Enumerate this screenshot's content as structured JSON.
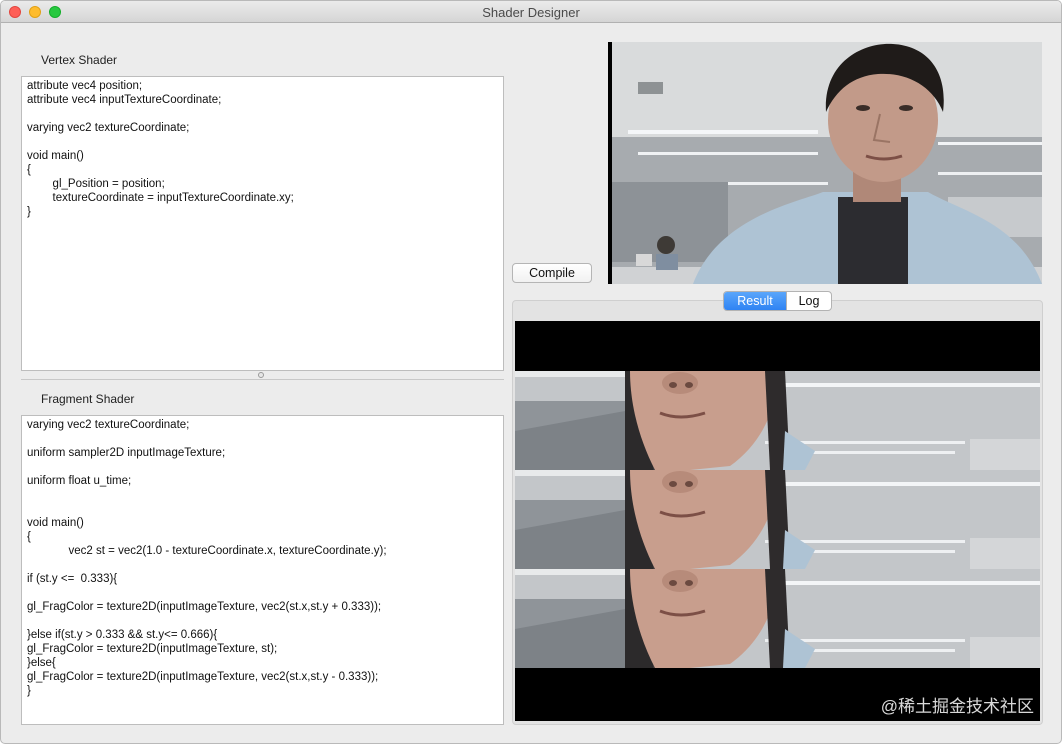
{
  "window": {
    "title": "Shader Designer"
  },
  "vertex": {
    "label": "Vertex Shader",
    "code": "attribute vec4 position;\nattribute vec4 inputTextureCoordinate;\n\nvarying vec2 textureCoordinate;\n\nvoid main()\n{\n        gl_Position = position;\n        textureCoordinate = inputTextureCoordinate.xy;\n}"
  },
  "fragment": {
    "label": "Fragment Shader",
    "code": "varying vec2 textureCoordinate;\n\nuniform sampler2D inputImageTexture;\n\nuniform float u_time;\n\n\nvoid main()\n{\n             vec2 st = vec2(1.0 - textureCoordinate.x, textureCoordinate.y);\n\nif (st.y <=  0.333){\n\ngl_FragColor = texture2D(inputImageTexture, vec2(st.x,st.y + 0.333));\n\n}else if(st.y > 0.333 && st.y<= 0.666){\ngl_FragColor = texture2D(inputImageTexture, st);\n}else{\ngl_FragColor = texture2D(inputImageTexture, vec2(st.x,st.y - 0.333));\n}"
  },
  "toolbar": {
    "compile_label": "Compile"
  },
  "output_tabs": {
    "result_label": "Result",
    "log_label": "Log",
    "selected": "Result"
  },
  "watermark": "@稀土掘金技术社区",
  "colors": {
    "accent": "#2f83f3",
    "background": "#ececec"
  }
}
